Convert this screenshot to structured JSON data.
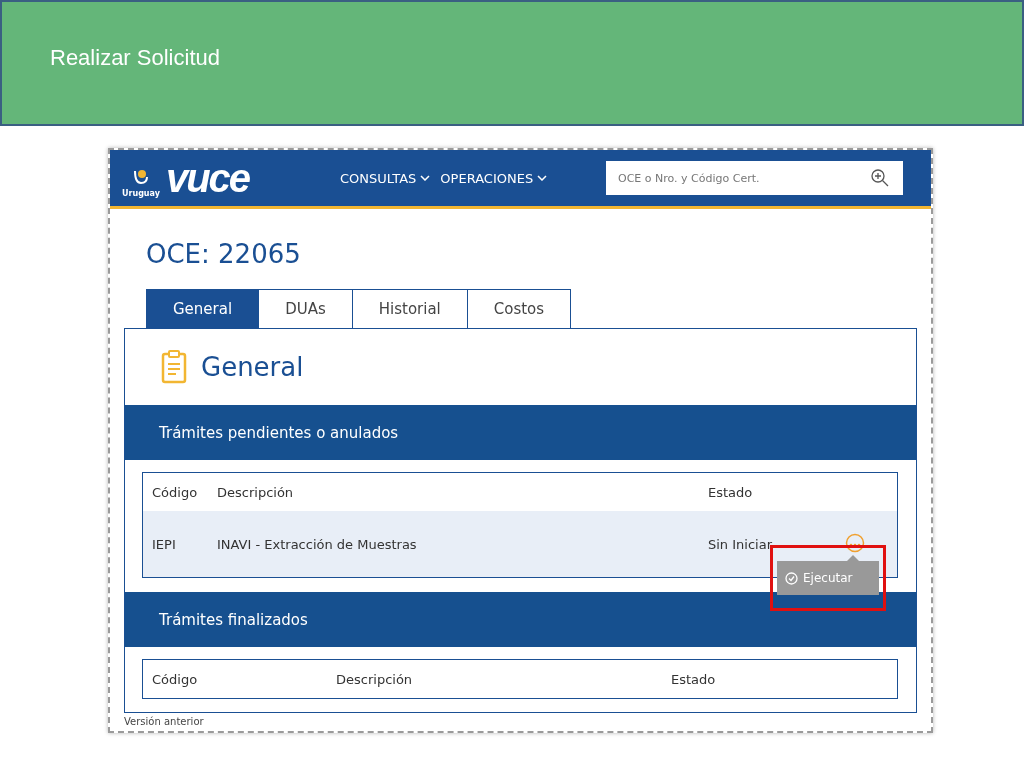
{
  "slide_title": "Realizar Solicitud",
  "header": {
    "logo_text": "vuce",
    "logo_caption": "Uruguay",
    "nav": [
      {
        "label": "CONSULTAS"
      },
      {
        "label": "OPERACIONES"
      }
    ],
    "search": {
      "placeholder": "OCE o Nro. y Código Cert."
    }
  },
  "page_title": "OCE: 22065",
  "tabs": [
    {
      "label": "General",
      "selected": true
    },
    {
      "label": "DUAs",
      "selected": false
    },
    {
      "label": "Historial",
      "selected": false
    },
    {
      "label": "Costos",
      "selected": false
    }
  ],
  "panel_title": "General",
  "sections": [
    {
      "title": "Trámites pendientes o anulados",
      "columns": [
        "Código",
        "Descripción",
        "Estado"
      ],
      "rows": [
        {
          "cells": [
            "IEPI",
            "INAVI - Extracción de Muestras",
            "Sin Iniciar"
          ],
          "tooltip": "Ejecutar"
        }
      ]
    },
    {
      "title": "Trámites finalizados",
      "columns": [
        "Código",
        "Descripción",
        "Estado"
      ]
    }
  ],
  "footer_link": "Versión anterior"
}
